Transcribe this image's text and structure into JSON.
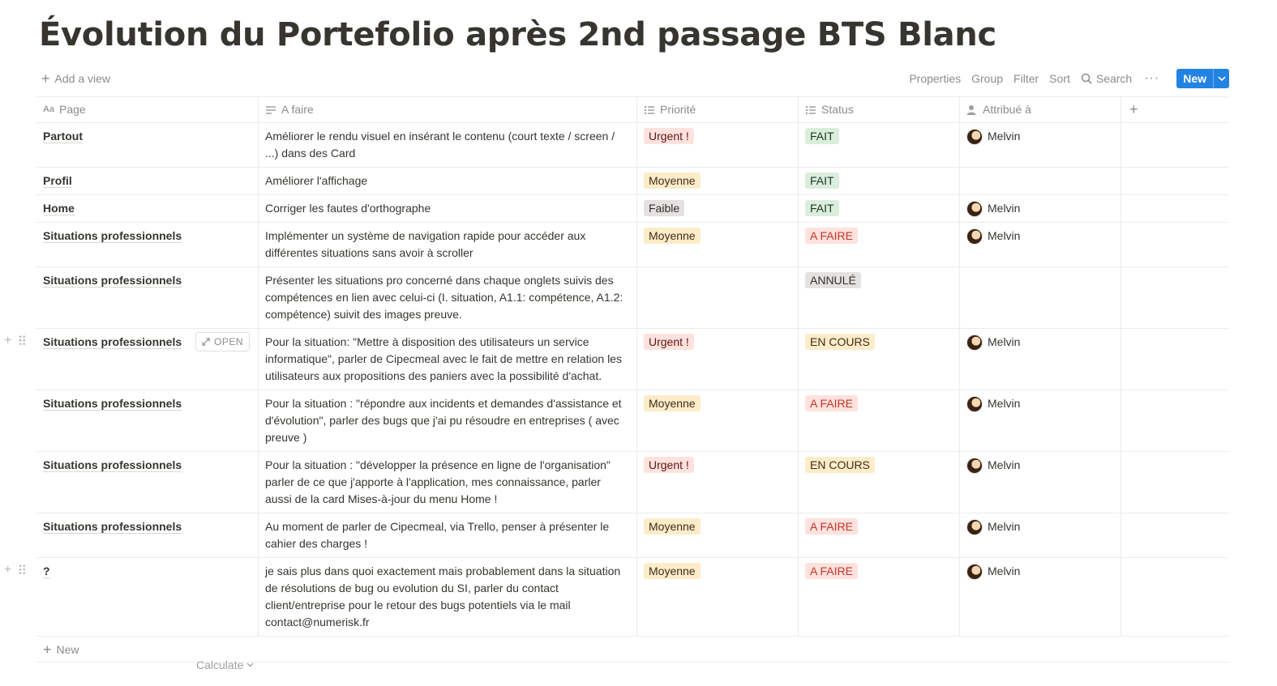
{
  "title": "Évolution du Portefolio après 2nd passage BTS Blanc",
  "toolbar": {
    "add_view": "Add a view",
    "properties": "Properties",
    "group": "Group",
    "filter": "Filter",
    "sort": "Sort",
    "search": "Search",
    "more": "···",
    "new": "New"
  },
  "columns": {
    "page": "Page",
    "a_faire": "A faire",
    "priorite": "Priorité",
    "status": "Status",
    "attribue": "Attribué à"
  },
  "rows": [
    {
      "page": "Partout",
      "a_faire": "Améliorer le rendu visuel en insérant le contenu (court texte / screen / ...) dans des Card",
      "priorite": "Urgent !",
      "status": "FAIT",
      "attribue": "Melvin"
    },
    {
      "page": "Profil",
      "a_faire": "Améliorer l'affichage",
      "priorite": "Moyenne",
      "status": "FAIT",
      "attribue": ""
    },
    {
      "page": "Home",
      "a_faire": "Corriger les fautes d'orthographe",
      "priorite": "Faible",
      "status": "FAIT",
      "attribue": "Melvin"
    },
    {
      "page": "Situations professionnels",
      "a_faire": "Implémenter un système de navigation rapide pour accéder aux différentes situations sans avoir à scroller",
      "priorite": "Moyenne",
      "status": "A FAIRE",
      "attribue": "Melvin"
    },
    {
      "page": "Situations professionnels",
      "a_faire": "Présenter les situations pro concerné dans chaque onglets suivis des compétences en lien avec celui-ci (I. situation, A1.1: compétence, A1.2: compétence) suivit des images preuve.",
      "priorite": "",
      "status": "ANNULÉ",
      "attribue": ""
    },
    {
      "page": "Situations professionnels",
      "a_faire": "Pour la situation: \"Mettre à disposition des utilisateurs un service informatique\", parler de Cipecmeal avec le fait de mettre en relation les utilisateurs aux propositions des paniers avec la possibilité d'achat.",
      "priorite": "Urgent !",
      "status": "EN COURS",
      "attribue": "Melvin",
      "open": "OPEN"
    },
    {
      "page": "Situations professionnels",
      "a_faire": "Pour la situation : \"répondre aux incidents et demandes d'assistance et d'évolution\", parler des bugs que j'ai pu résoudre en entreprises ( avec preuve )",
      "priorite": "Moyenne",
      "status": "A FAIRE",
      "attribue": "Melvin"
    },
    {
      "page": "Situations professionnels",
      "a_faire": "Pour la situation : \"développer la présence en ligne de l'organisation\" parler de ce que j'apporte à l'application, mes connaissance, parler aussi de la card Mises-à-jour du menu Home !",
      "priorite": "Urgent !",
      "status": "EN COURS",
      "attribue": "Melvin"
    },
    {
      "page": "Situations professionnels",
      "a_faire": "Au moment de parler de Cipecmeal, via Trello, penser à présenter le cahier des charges !",
      "priorite": "Moyenne",
      "status": "A FAIRE",
      "attribue": "Melvin"
    },
    {
      "page": "?",
      "a_faire": "je sais plus dans quoi exactement mais probablement dans la situation de résolutions de bug ou evolution du SI, parler du contact client/entreprise pour le retour des bugs potentiels via le mail contact@numerisk.fr",
      "priorite": "Moyenne",
      "status": "A FAIRE",
      "attribue": "Melvin"
    }
  ],
  "tag_colors": {
    "Urgent !": {
      "bg": "#ffe2dd",
      "fg": "#5d1715"
    },
    "Moyenne": {
      "bg": "#fdecc8",
      "fg": "#402c1b"
    },
    "Faible": {
      "bg": "#e3e2e0",
      "fg": "#32302c"
    },
    "FAIT": {
      "bg": "#dbeddb",
      "fg": "#1c3829"
    },
    "A FAIRE": {
      "bg": "#ffe2dd",
      "fg": "#c4332a"
    },
    "ANNULÉ": {
      "bg": "#e3e2e0",
      "fg": "#32302c"
    },
    "EN COURS": {
      "bg": "#fdecc8",
      "fg": "#402c1b"
    }
  },
  "footer": {
    "new_row": "New",
    "calculate": "Calculate"
  }
}
